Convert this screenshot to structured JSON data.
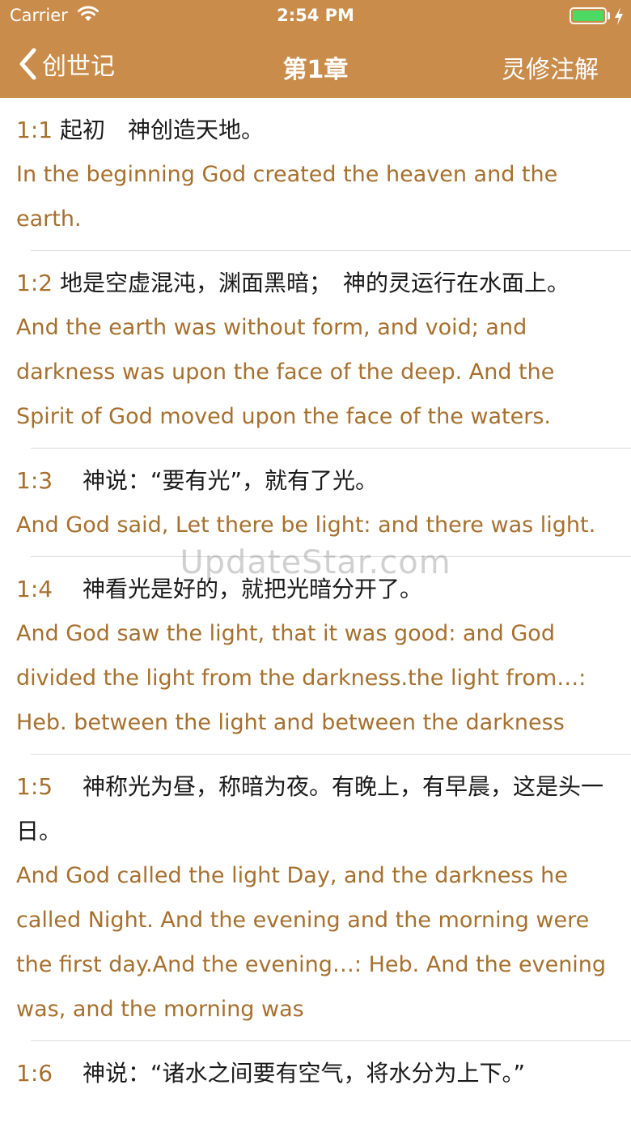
{
  "status_bar": {
    "carrier": "Carrier",
    "time": "2:54 PM"
  },
  "nav": {
    "back_label": "创世记",
    "title": "第1章",
    "right_label": "灵修注解"
  },
  "verses": [
    {
      "number": "1:1",
      "cn": "起初　神创造天地。",
      "en": "In the beginning God created the heaven and the earth."
    },
    {
      "number": "1:2",
      "cn": "地是空虚混沌，渊面黑暗；　神的灵运行在水面上。",
      "en": "And the earth was without form, and void; and darkness was upon the face of the deep. And the Spirit of God moved upon the face of the waters."
    },
    {
      "number": "1:3",
      "cn": "　神说：“要有光”，就有了光。",
      "en": "And God said, Let there be light: and there was light."
    },
    {
      "number": "1:4",
      "cn": "　神看光是好的，就把光暗分开了。",
      "en": "And God saw the light, that it was good: and God divided the light from the darkness.the light from…: Heb. between the light and between the darkness"
    },
    {
      "number": "1:5",
      "cn": "　神称光为昼，称暗为夜。有晚上，有早晨，这是头一日。",
      "en": "And God called the light Day, and the darkness he called Night. And the evening and the morning were the first day.And the evening…: Heb. And the evening was, and the morning was"
    },
    {
      "number": "1:6",
      "cn": "　神说：“诸水之间要有空气，将水分为上下。”",
      "en": ""
    }
  ],
  "watermark": "UpdateStar.com",
  "colors": {
    "nav_background": "#C98C4B",
    "verse_accent": "#A6702E",
    "battery": "#4CD964"
  }
}
